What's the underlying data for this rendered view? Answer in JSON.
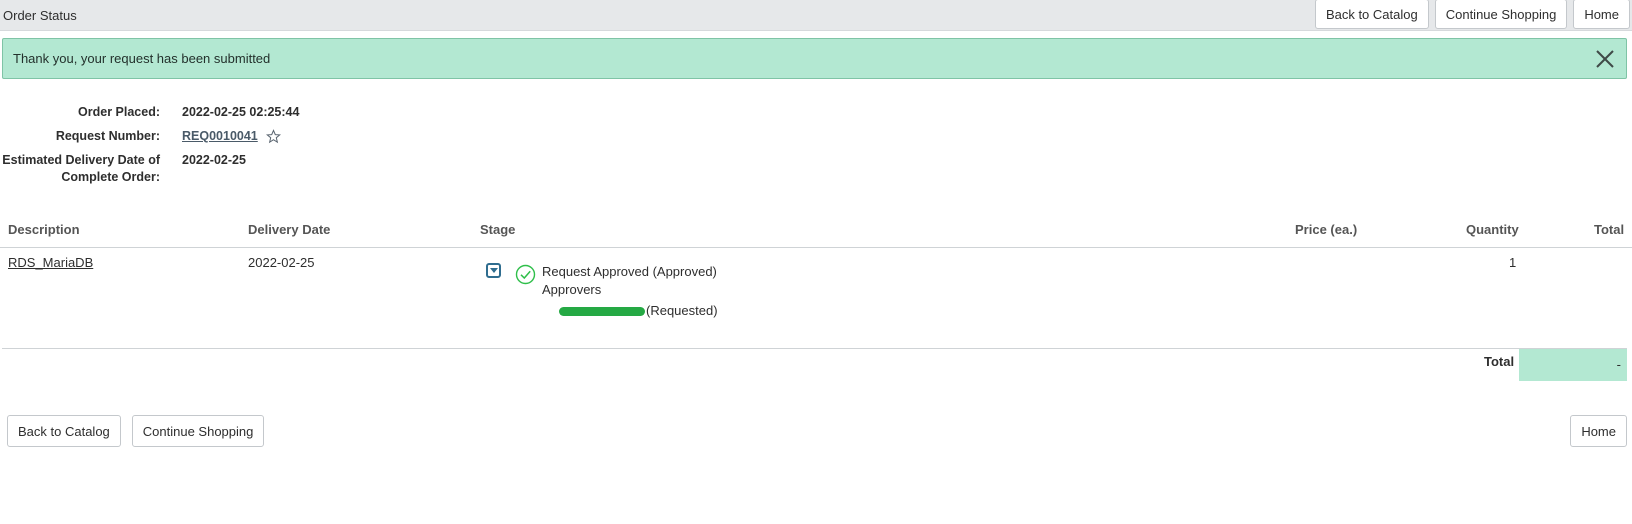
{
  "header": {
    "title": "Order Status",
    "buttons": {
      "back": "Back to Catalog",
      "continue": "Continue Shopping",
      "home": "Home"
    }
  },
  "alert": {
    "message": "Thank you, your request has been submitted"
  },
  "order": {
    "placed_label": "Order Placed:",
    "placed_value": "2022-02-25 02:25:44",
    "request_label": "Request Number:",
    "request_value": "REQ0010041",
    "delivery_label_1": "Estimated Delivery Date of",
    "delivery_label_2": "Complete Order:",
    "delivery_value": "2022-02-25"
  },
  "table": {
    "headers": {
      "description": "Description",
      "delivery_date": "Delivery Date",
      "stage": "Stage",
      "price": "Price (ea.)",
      "quantity": "Quantity",
      "total": "Total"
    },
    "rows": [
      {
        "description": "RDS_MariaDB",
        "delivery_date": "2022-02-25",
        "stage_status": "Request Approved (Approved)",
        "approvers_label": "Approvers",
        "approver_status": "(Requested)",
        "quantity": "1"
      }
    ],
    "footer": {
      "total_label": "Total",
      "total_value": "-"
    }
  },
  "footer_buttons": {
    "back": "Back to Catalog",
    "continue": "Continue Shopping",
    "home": "Home"
  },
  "colors": {
    "alert_bg": "#b3e8d2",
    "approved_green": "#2fbf4a",
    "redaction": "#25a944"
  }
}
